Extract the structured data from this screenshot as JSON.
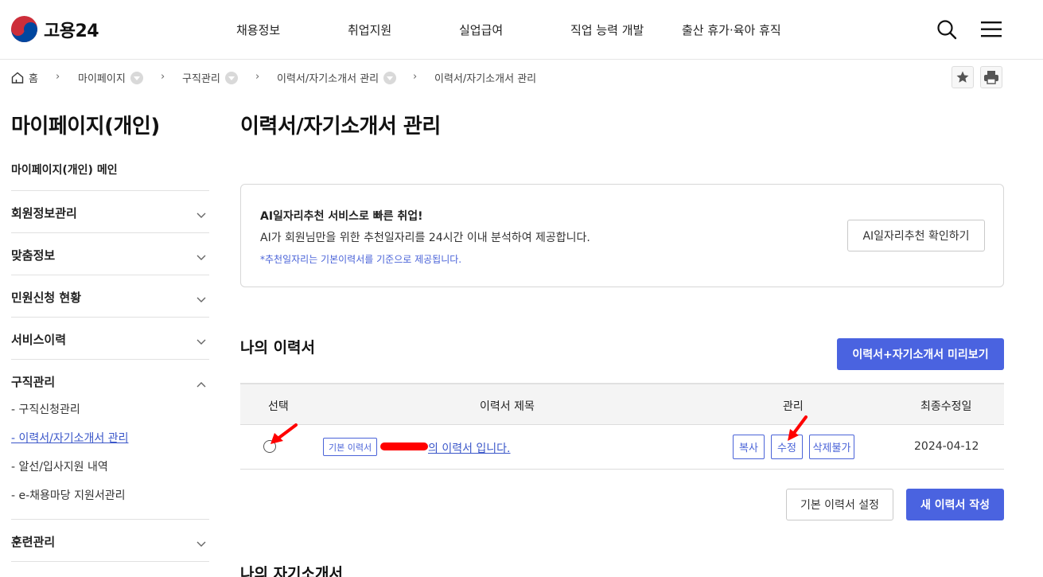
{
  "header": {
    "logo_text": "고용24",
    "menu": [
      "채용정보",
      "취업지원",
      "실업급여",
      "직업 능력 개발",
      "출산 휴가·육아 휴직"
    ]
  },
  "breadcrumb": {
    "home": "홈",
    "items": [
      "마이페이지",
      "구직관리",
      "이력서/자기소개서 관리",
      "이력서/자기소개서 관리"
    ]
  },
  "sidebar": {
    "title": "마이페이지(개인)",
    "main_link": "마이페이지(개인) 메인",
    "sections": [
      "회원정보관리",
      "맞춤정보",
      "민원신청 현황",
      "서비스이력",
      "구직관리",
      "훈련관리"
    ],
    "sub_items": [
      "- 구직신청관리",
      "- 이력서/자기소개서 관리",
      "- 알선/입사지원 내역",
      "- e-채용마당 지원서관리"
    ]
  },
  "main": {
    "page_title": "이력서/자기소개서 관리",
    "ai_box": {
      "title": "AI일자리추천 서비스로 빠른 취업!",
      "desc": "AI가 회원님만을 위한 추천일자리를 24시간 이내 분석하여 제공합니다.",
      "note": "*추천일자리는 기본이력서를 기준으로 제공됩니다.",
      "button": "AI일자리추천 확인하기"
    },
    "resume_section": {
      "title": "나의 이력서",
      "preview_button": "이력서+자기소개서 미리보기",
      "columns": [
        "선택",
        "이력서 제목",
        "관리",
        "최종수정일"
      ],
      "rows": [
        {
          "tag": "기본 이력서",
          "title": "의 이력서 입니다.",
          "actions": [
            "복사",
            "수정",
            "삭제불가"
          ],
          "date": "2024-04-12"
        }
      ],
      "default_button": "기본 이력서 설정",
      "new_button": "새 이력서 작성"
    },
    "cover_section": {
      "title": "나의 자기소개서"
    }
  },
  "colors": {
    "accent": "#4a63e0",
    "link": "#3a56c9",
    "annotation": "#ff0000"
  }
}
